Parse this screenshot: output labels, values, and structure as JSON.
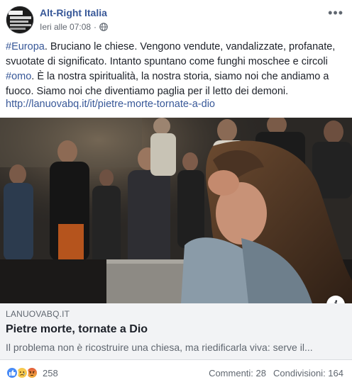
{
  "post": {
    "author": "Alt-Right Italia",
    "time": "Ieri alle 07:08",
    "separator": "·",
    "more": "•••",
    "text_segments": [
      {
        "type": "hashtag",
        "text": "#Europa"
      },
      {
        "type": "text",
        "text": ". Bruciano le chiese. Vengono vendute, vandalizzate, profanate, svuotate di significato. Intanto spuntano come funghi moschee e circoli "
      },
      {
        "type": "hashtag",
        "text": "#omo"
      },
      {
        "type": "text",
        "text": ". È la nostra spiritualità, la nostra storia, siamo noi che andiamo a fuoco. Siamo noi che diventiamo paglia per il letto dei demoni."
      }
    ],
    "link": "http://lanuovabq.it/it/pietre-morte-tornate-a-dio"
  },
  "card": {
    "domain": "LANUOVABQ.IT",
    "title": "Pietre morte, tornate a Dio",
    "description": "Il problema non è ricostruire una chiesa, ma riedificarla viva: serve il...",
    "info_label": "i"
  },
  "footer": {
    "reaction_count": "258",
    "comments": "Commenti: 28",
    "shares": "Condivisioni: 164"
  },
  "icons": {
    "reactions": [
      "like-icon",
      "sad-icon",
      "angry-icon"
    ],
    "privacy": "globe-icon",
    "menu": "more-icon"
  }
}
